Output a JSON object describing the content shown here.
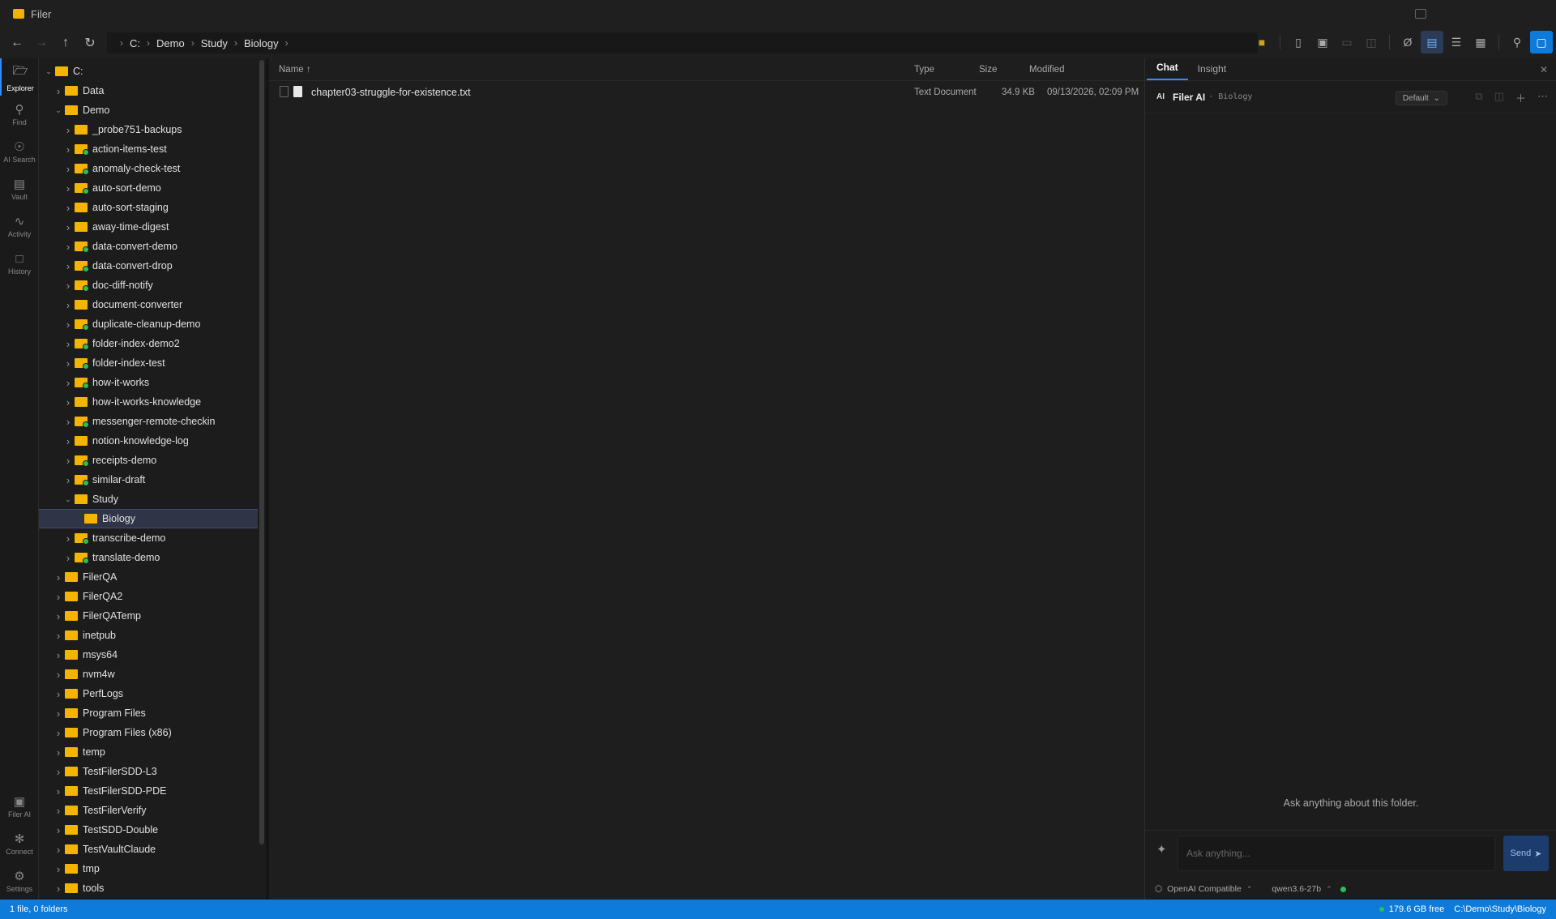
{
  "window": {
    "title": "Filer"
  },
  "toolbar": {
    "back_icon": "arrow-left-icon",
    "forward_icon": "arrow-right-icon",
    "up_icon": "arrow-up-icon",
    "refresh_icon": "refresh-icon",
    "breadcrumb": [
      "C:",
      "Demo",
      "Study",
      "Biology"
    ]
  },
  "activity_bar": {
    "top": [
      {
        "label": "Explorer",
        "icon": "folder-open-icon",
        "active": true
      },
      {
        "label": "Find",
        "icon": "search-icon"
      },
      {
        "label": "AI Search",
        "icon": "compass-icon"
      },
      {
        "label": "Vault",
        "icon": "vault-icon"
      },
      {
        "label": "Activity",
        "icon": "activity-icon"
      },
      {
        "label": "History",
        "icon": "chat-bubble-icon"
      }
    ],
    "bottom": [
      {
        "label": "Filer AI",
        "icon": "robot-icon"
      },
      {
        "label": "Connect",
        "icon": "puzzle-icon"
      },
      {
        "label": "Settings",
        "icon": "gear-icon"
      }
    ]
  },
  "tree": [
    {
      "label": "C:",
      "depth": 0,
      "expanded": true
    },
    {
      "label": "Data",
      "depth": 1
    },
    {
      "label": "Demo",
      "depth": 1,
      "expanded": true
    },
    {
      "label": "_probe751-backups",
      "depth": 2
    },
    {
      "label": "action-items-test",
      "depth": 2,
      "watched": true
    },
    {
      "label": "anomaly-check-test",
      "depth": 2,
      "watched": true
    },
    {
      "label": "auto-sort-demo",
      "depth": 2,
      "watched": true
    },
    {
      "label": "auto-sort-staging",
      "depth": 2
    },
    {
      "label": "away-time-digest",
      "depth": 2
    },
    {
      "label": "data-convert-demo",
      "depth": 2,
      "watched": true
    },
    {
      "label": "data-convert-drop",
      "depth": 2,
      "watched": true
    },
    {
      "label": "doc-diff-notify",
      "depth": 2,
      "watched": true
    },
    {
      "label": "document-converter",
      "depth": 2
    },
    {
      "label": "duplicate-cleanup-demo",
      "depth": 2,
      "watched": true
    },
    {
      "label": "folder-index-demo2",
      "depth": 2,
      "watched": true
    },
    {
      "label": "folder-index-test",
      "depth": 2,
      "watched": true
    },
    {
      "label": "how-it-works",
      "depth": 2,
      "watched": true
    },
    {
      "label": "how-it-works-knowledge",
      "depth": 2
    },
    {
      "label": "messenger-remote-checkin",
      "depth": 2,
      "watched": true
    },
    {
      "label": "notion-knowledge-log",
      "depth": 2
    },
    {
      "label": "receipts-demo",
      "depth": 2,
      "watched": true
    },
    {
      "label": "similar-draft",
      "depth": 2,
      "watched": true
    },
    {
      "label": "Study",
      "depth": 2,
      "expanded": true
    },
    {
      "label": "Biology",
      "depth": 3,
      "selected": true,
      "leaf": true
    },
    {
      "label": "transcribe-demo",
      "depth": 2,
      "watched": true
    },
    {
      "label": "translate-demo",
      "depth": 2,
      "watched": true
    },
    {
      "label": "FilerQA",
      "depth": 1
    },
    {
      "label": "FilerQA2",
      "depth": 1
    },
    {
      "label": "FilerQATemp",
      "depth": 1
    },
    {
      "label": "inetpub",
      "depth": 1
    },
    {
      "label": "msys64",
      "depth": 1
    },
    {
      "label": "nvm4w",
      "depth": 1
    },
    {
      "label": "PerfLogs",
      "depth": 1
    },
    {
      "label": "Program Files",
      "depth": 1
    },
    {
      "label": "Program Files (x86)",
      "depth": 1
    },
    {
      "label": "temp",
      "depth": 1
    },
    {
      "label": "TestFilerSDD-L3",
      "depth": 1
    },
    {
      "label": "TestFilerSDD-PDE",
      "depth": 1
    },
    {
      "label": "TestFilerVerify",
      "depth": 1
    },
    {
      "label": "TestSDD-Double",
      "depth": 1
    },
    {
      "label": "TestVaultClaude",
      "depth": 1
    },
    {
      "label": "tmp",
      "depth": 1
    },
    {
      "label": "tools",
      "depth": 1
    }
  ],
  "file_list": {
    "columns": {
      "name": "Name ↑",
      "type": "Type",
      "size": "Size",
      "modified": "Modified"
    },
    "rows": [
      {
        "name": "chapter03-struggle-for-existence.txt",
        "type": "Text Document",
        "size": "34.9 KB",
        "modified": "09/13/2026, 02:09 PM"
      }
    ]
  },
  "chat": {
    "tabs": [
      "Chat",
      "Insight"
    ],
    "close_icon": "close-icon",
    "ai_badge": "AI",
    "title": "Filer AI",
    "subtitle": "· Biology",
    "model_select": "Default",
    "empty_text": "Ask anything about this folder.",
    "input_placeholder": "Ask anything...",
    "send_label": "Send",
    "provider": "OpenAI Compatible",
    "model": "qwen3.6-27b"
  },
  "statusbar": {
    "left": "1 file, 0 folders",
    "free_space": "179.6 GB free",
    "path": "C:\\Demo\\Study\\Biology"
  },
  "colors": {
    "accent": "#0e7ad9",
    "folder": "#f4b400",
    "online": "#2dbd5a"
  }
}
